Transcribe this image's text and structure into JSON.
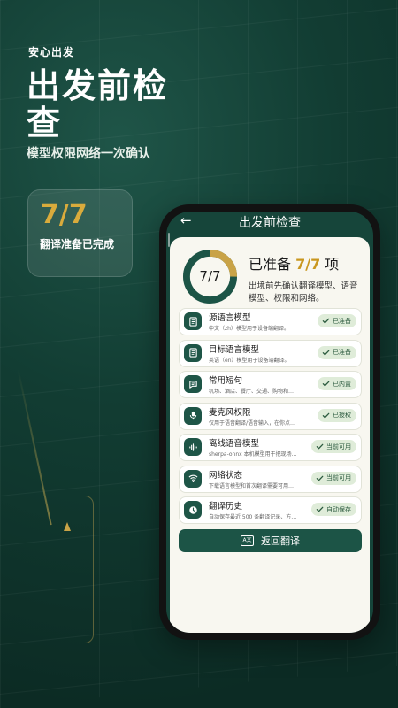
{
  "hero": {
    "kicker": "安心出发",
    "title_line1": "出发前检",
    "title_line2": "查",
    "subtitle": "模型权限网络一次确认"
  },
  "stat_card": {
    "value": "7/7",
    "label": "翻译准备已完成"
  },
  "phone": {
    "topbar": {
      "back_icon": "arrow-left-icon",
      "title": "出发前检查"
    },
    "summary": {
      "progress": {
        "done": 7,
        "total": 7,
        "fraction": 1.0
      },
      "ring_label": "7/7",
      "title_prefix": "已准备 ",
      "title_count": "7/7",
      "title_suffix": " 项",
      "description": "出境前先确认翻译模型、语音模型、权限和网络。"
    },
    "checks": [
      {
        "icon": "document-icon",
        "title": "源语言模型",
        "desc": "中文（zh）模型用于设备端翻译。",
        "status": "已准备"
      },
      {
        "icon": "document-icon",
        "title": "目标语言模型",
        "desc": "英语（en）模型用于设备端翻译。",
        "status": "已准备"
      },
      {
        "icon": "chat-bubble-icon",
        "title": "常用短句",
        "desc": "机场、酒店、餐厅、交通、购物和紧急…",
        "status": "已内置"
      },
      {
        "icon": "microphone-icon",
        "title": "麦克风权限",
        "desc": "仅用于语音翻译/语音输入，在你点击…",
        "status": "已授权"
      },
      {
        "icon": "waveform-icon",
        "title": "离线语音模型",
        "desc": "sherpa-onnx 本机模型用于把现场语…",
        "status": "当前可用"
      },
      {
        "icon": "wifi-icon",
        "title": "网络状态",
        "desc": "下载语言模型和首次翻译需要可用网…",
        "status": "当前可用"
      },
      {
        "icon": "clock-icon",
        "title": "翻译历史",
        "desc": "自动保存最近 500 条翻译记录、方…",
        "status": "自动保存"
      }
    ],
    "cta": {
      "icon": "translate-icon",
      "icon_text": "A文",
      "label": "返回翻译"
    }
  },
  "colors": {
    "bg_dark": "#0c2b24",
    "bg_green": "#1f5548",
    "accent_gold": "#d9ab3c",
    "button_green": "#1c5446",
    "badge_green": "#dfecd9"
  }
}
